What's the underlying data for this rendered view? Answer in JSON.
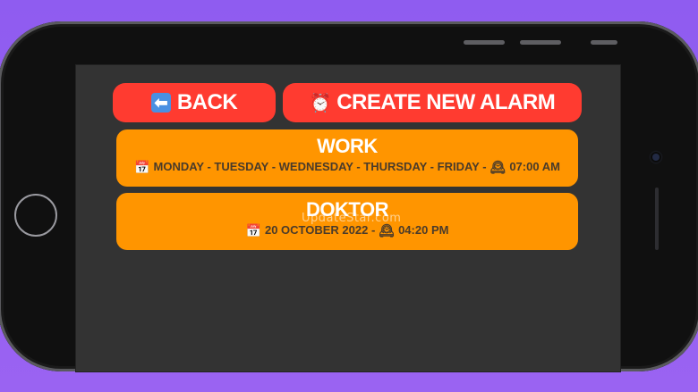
{
  "buttons": {
    "back_label": "BACK",
    "create_label": "CREATE NEW ALARM"
  },
  "alarms": [
    {
      "title": "WORK",
      "schedule": "MONDAY - TUESDAY - WEDNESDAY - THURSDAY - FRIDAY -",
      "time": "07:00 AM"
    },
    {
      "title": "DOKTOR",
      "schedule": "20 OCTOBER 2022 -",
      "time": "04:20 PM"
    }
  ],
  "watermark": "UpdateStar.com",
  "icons": {
    "back": "left-arrow-icon",
    "create": "alarm-clock-icon",
    "calendar": "calendar-icon",
    "clock": "mantel-clock-icon"
  },
  "colors": {
    "background": "#9a63f2",
    "screen": "#333333",
    "button": "#ff3b30",
    "card": "#ff9500"
  }
}
